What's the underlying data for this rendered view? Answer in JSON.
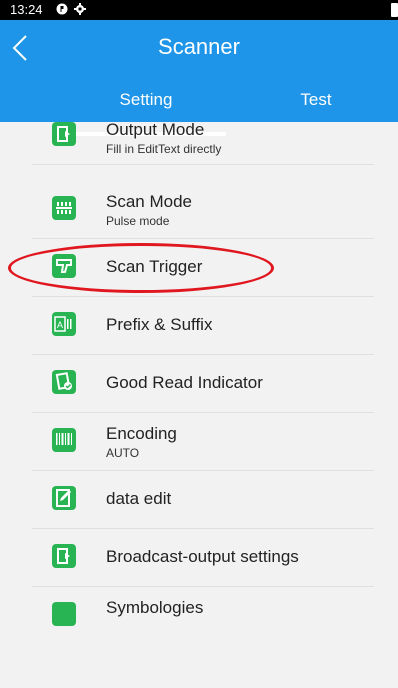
{
  "status": {
    "time": "13:24"
  },
  "appbar": {
    "title": "Scanner"
  },
  "tabs": [
    {
      "label": "Setting"
    },
    {
      "label": "Test"
    }
  ],
  "items": [
    {
      "title": "Output Mode",
      "subtitle": "Fill in EditText directly",
      "icon": "output-icon"
    },
    {
      "title": "Scan Mode",
      "subtitle": "Pulse mode",
      "icon": "scan-mode-icon"
    },
    {
      "title": "Scan Trigger",
      "subtitle": "",
      "icon": "trigger-icon"
    },
    {
      "title": "Prefix & Suffix",
      "subtitle": "",
      "icon": "prefix-suffix-icon"
    },
    {
      "title": "Good Read Indicator",
      "subtitle": "",
      "icon": "good-read-icon"
    },
    {
      "title": "Encoding",
      "subtitle": "AUTO",
      "icon": "barcode-icon"
    },
    {
      "title": "data edit",
      "subtitle": "",
      "icon": "edit-icon"
    },
    {
      "title": "Broadcast-output settings",
      "subtitle": "",
      "icon": "broadcast-icon"
    },
    {
      "title": "Symbologies",
      "subtitle": "",
      "icon": "symbology-icon"
    }
  ],
  "colors": {
    "accent": "#1e95e8",
    "icon_bg": "#29b454",
    "highlight": "#e0171f"
  }
}
